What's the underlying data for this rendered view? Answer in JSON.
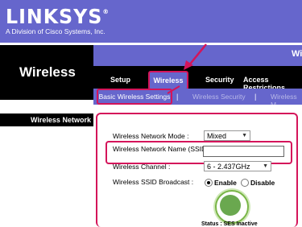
{
  "brand": {
    "logo": "LINKSYS",
    "registered": "®",
    "tagline": "A Division of Cisco Systems, Inc."
  },
  "header": {
    "right_letter": "Wi",
    "section_title": "Wireless"
  },
  "tabs": [
    {
      "label": "Setup"
    },
    {
      "label": "Wireless",
      "active": true
    },
    {
      "label": "Security"
    },
    {
      "label": "Access Restrictions"
    }
  ],
  "subtabs": [
    {
      "label": "Basic Wireless Settings",
      "active": true
    },
    {
      "label": "Wireless Security"
    },
    {
      "label": "Wireless M"
    }
  ],
  "separators": [
    "|",
    "|"
  ],
  "sidebar": {
    "heading": "Wireless Network"
  },
  "form": {
    "mode": {
      "label": "Wireless Network Mode :",
      "value": "Mixed"
    },
    "ssid": {
      "label": "Wireless Network Name (SSID)",
      "value": ""
    },
    "channel": {
      "label": "Wireless Channel :",
      "value": "6 - 2.437GHz"
    },
    "broadcast": {
      "label": "Wireless SSID Broadcast :",
      "options": [
        {
          "label": "Enable",
          "checked": true
        },
        {
          "label": "Disable",
          "checked": false
        }
      ]
    }
  },
  "ses": {
    "status": "Status : SES Inactive"
  },
  "colors": {
    "brand": "#6666cc",
    "highlight": "#d4145a",
    "black": "#000000"
  }
}
